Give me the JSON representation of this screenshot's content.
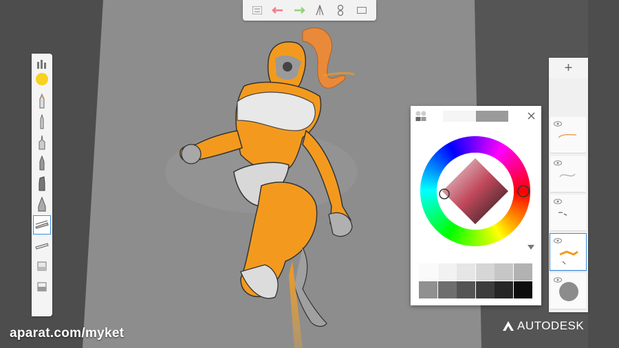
{
  "app": {
    "accent_color": "#3a8ee6",
    "panel_color": "#f2f2f2"
  },
  "top_toolbar": {
    "items": [
      "list-icon",
      "undo-icon",
      "redo-icon",
      "ruler-tools-icon",
      "symmetry-icon",
      "fullscreen-icon"
    ]
  },
  "brush_panel": {
    "current_color": "#f7d21e",
    "brushes": [
      "pencil",
      "ballpoint-pen",
      "marker",
      "felt-pen",
      "chisel-marker",
      "airbrush",
      "smudge-selected",
      "blender",
      "eraser",
      "hard-eraser"
    ],
    "selected_index": 6
  },
  "color_editor": {
    "current_color_hex": "#9a9a9a",
    "previous_color_hex": "#f5f5f5",
    "swatches_row1": [
      "#fafafa",
      "#f2f2f2",
      "#e6e6e6",
      "#d6d6d6",
      "#c6c6c6",
      "#b2b2b2"
    ],
    "swatches_row2": [
      "#909090",
      "#6e6e6e",
      "#545454",
      "#3c3c3c",
      "#262626",
      "#0d0d0d"
    ]
  },
  "layers": {
    "add_label": "+",
    "count": 5,
    "active_index": 3,
    "background_color": "#8c8c8c"
  },
  "watermark": {
    "text": "aparat.com/myket"
  },
  "brand": {
    "name": "AUTODESK"
  }
}
